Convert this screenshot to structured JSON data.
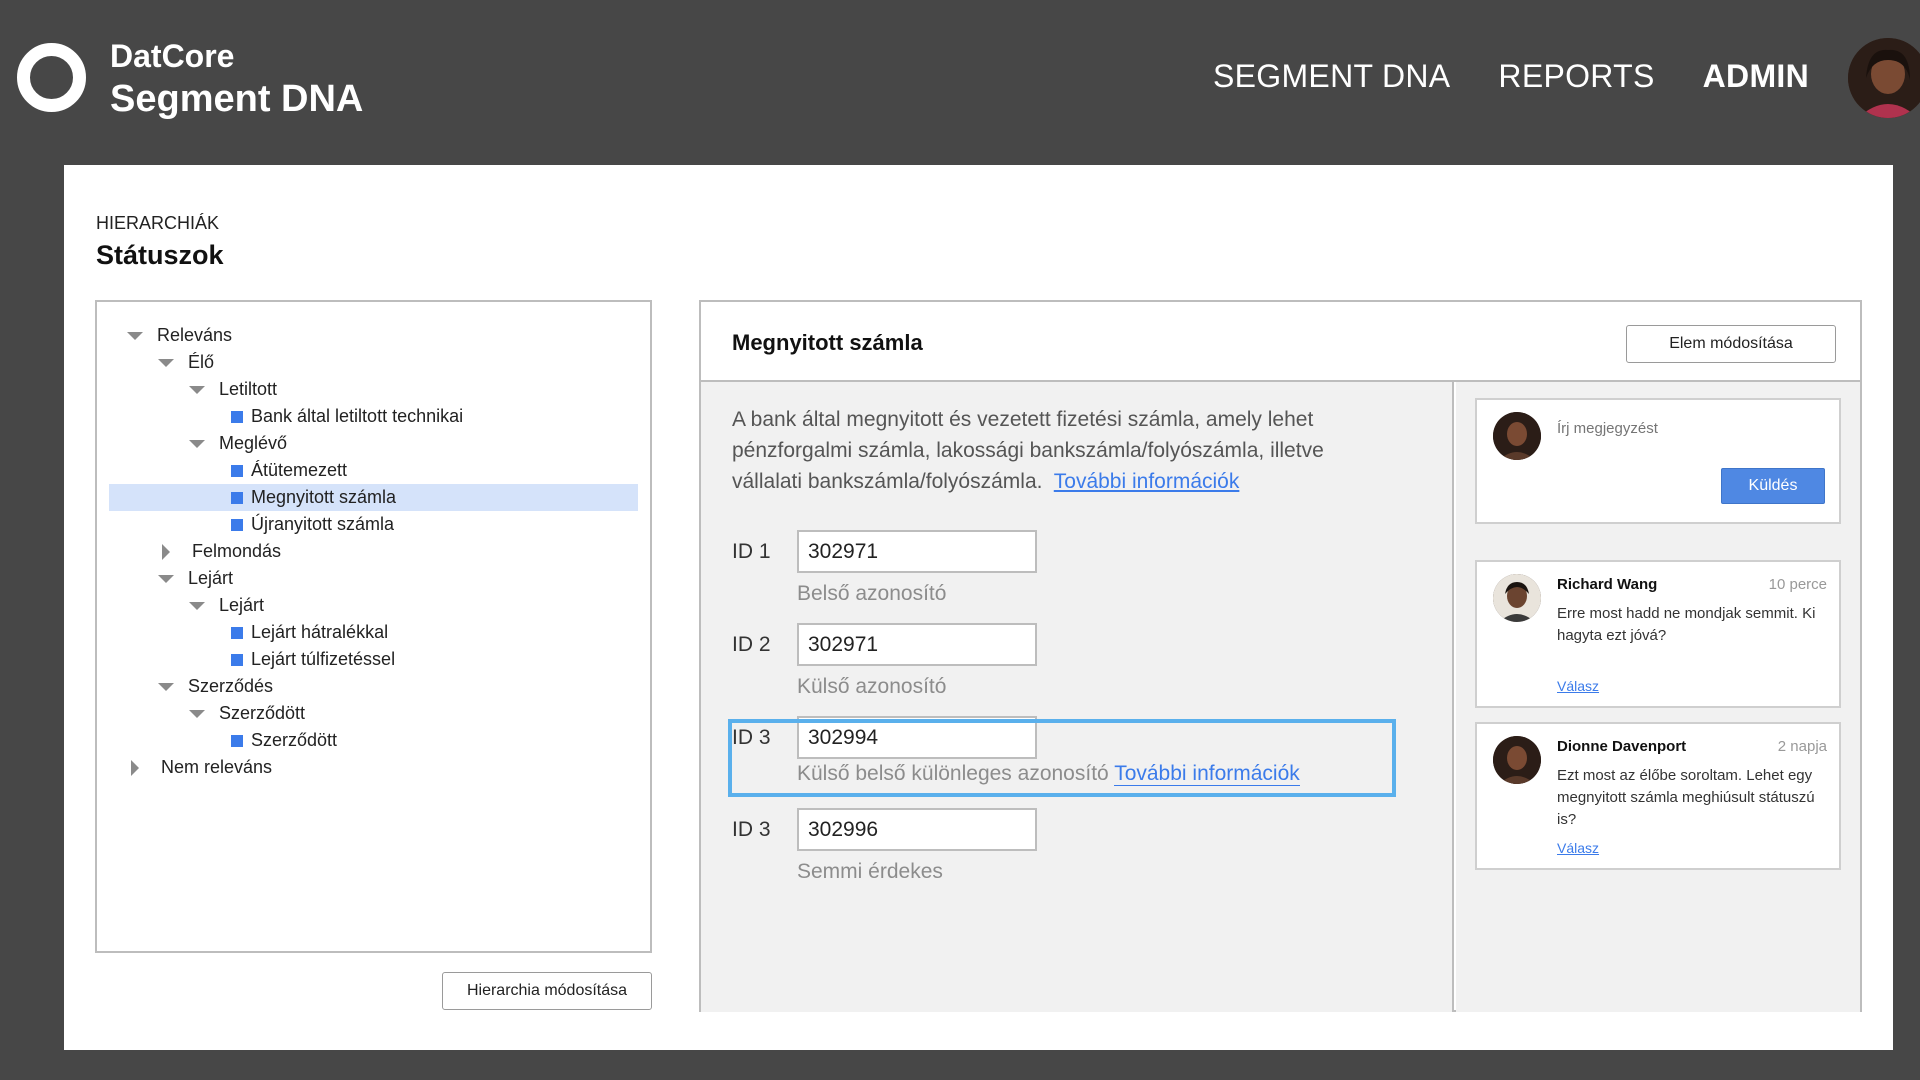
{
  "header": {
    "brand_top": "DatCore",
    "brand_main": "Segment DNA",
    "nav": [
      {
        "label": "SEGMENT DNA",
        "active": false
      },
      {
        "label": "REPORTS",
        "active": false
      },
      {
        "label": "ADMIN",
        "active": true
      }
    ],
    "avatar_icon": "user-avatar"
  },
  "page": {
    "eyebrow": "HIERARCHIÁK",
    "title": "Státuszok"
  },
  "tree": {
    "items": [
      {
        "label": "Releváns",
        "type": "expanded",
        "level": 0
      },
      {
        "label": "Élő",
        "type": "expanded",
        "level": 1
      },
      {
        "label": "Letiltott",
        "type": "expanded",
        "level": 2
      },
      {
        "label": "Bank által letiltott technikai",
        "type": "leaf",
        "level": 3
      },
      {
        "label": "Meglévő",
        "type": "expanded",
        "level": 2
      },
      {
        "label": "Átütemezett",
        "type": "leaf",
        "level": 3
      },
      {
        "label": "Megnyitott számla",
        "type": "leaf",
        "level": 3,
        "selected": true
      },
      {
        "label": "Újranyitott számla",
        "type": "leaf",
        "level": 3
      },
      {
        "label": "Felmondás",
        "type": "collapsed",
        "level": 1
      },
      {
        "label": "Lejárt",
        "type": "expanded",
        "level": 1
      },
      {
        "label": "Lejárt",
        "type": "expanded",
        "level": 2
      },
      {
        "label": "Lejárt hátralékkal",
        "type": "leaf",
        "level": 3
      },
      {
        "label": "Lejárt túlfizetéssel",
        "type": "leaf",
        "level": 3
      },
      {
        "label": "Szerződés",
        "type": "expanded",
        "level": 1
      },
      {
        "label": "Szerződött",
        "type": "expanded",
        "level": 2
      },
      {
        "label": "Szerződött",
        "type": "leaf",
        "level": 3
      },
      {
        "label": "Nem releváns",
        "type": "collapsed",
        "level": 0
      }
    ],
    "edit_button": "Hierarchia módosítása"
  },
  "detail": {
    "title": "Megnyitott számla",
    "edit_button": "Elem módosítása",
    "description": "A bank által megnyitott és vezetett fizetési számla, amely lehet pénzforgalmi számla, lakossági bankszámla/folyószámla, illetve vállalati bankszámla/folyószámla.",
    "more_info": "További információk",
    "fields": [
      {
        "label": "ID 1",
        "value": "302971",
        "hint": "Belső azonosító"
      },
      {
        "label": "ID 2",
        "value": "302971",
        "hint": "Külső azonosító"
      },
      {
        "label": "ID 3",
        "value": "302994",
        "hint": "Külső belső különleges azonosító",
        "hint_link": "További információk",
        "highlighted": true
      },
      {
        "label": "ID 3",
        "value": "302996",
        "hint": "Semmi érdekes"
      }
    ]
  },
  "comments": {
    "placeholder": "Írj megjegyzést",
    "send_label": "Küldés",
    "reply_label": "Válasz",
    "items": [
      {
        "author": "Richard Wang",
        "time": "10 perce",
        "text": "Erre most hadd ne mondjak semmit. Ki hagyta ezt jóvá?"
      },
      {
        "author": "Dionne Davenport",
        "time": "2 napja",
        "text": "Ezt most az élőbe soroltam. Lehet egy  megnyitott számla meghiúsult státuszú is?"
      }
    ]
  },
  "colors": {
    "background": "#474747",
    "accent": "#3b7bea",
    "selection": "#d5e3fa",
    "highlight": "#5ab0ec"
  }
}
